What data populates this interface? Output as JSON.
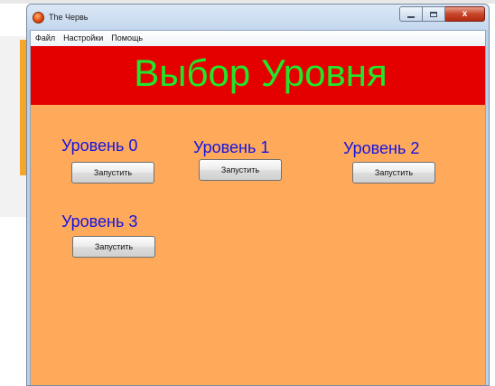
{
  "window": {
    "title": "The Червь",
    "controls": {
      "minimize": "",
      "maximize": "",
      "close": "x"
    }
  },
  "menu": {
    "items": [
      "Файл",
      "Настройки",
      "Помощь"
    ]
  },
  "banner": {
    "title": "Выбор Уровня"
  },
  "levels": [
    {
      "label": "Уровень 0",
      "button": "Запустить"
    },
    {
      "label": "Уровень 1",
      "button": "Запустить"
    },
    {
      "label": "Уровень 2",
      "button": "Запустить"
    },
    {
      "label": "Уровень 3",
      "button": "Запустить"
    }
  ],
  "colors": {
    "banner_background": "#e50000",
    "banner_text": "#22e52b",
    "client_background": "#ffa95b",
    "level_label": "#1414e0"
  },
  "icons": {
    "app": "app-icon",
    "minimize": "minimize-icon",
    "maximize": "maximize-icon",
    "close": "close-icon"
  }
}
